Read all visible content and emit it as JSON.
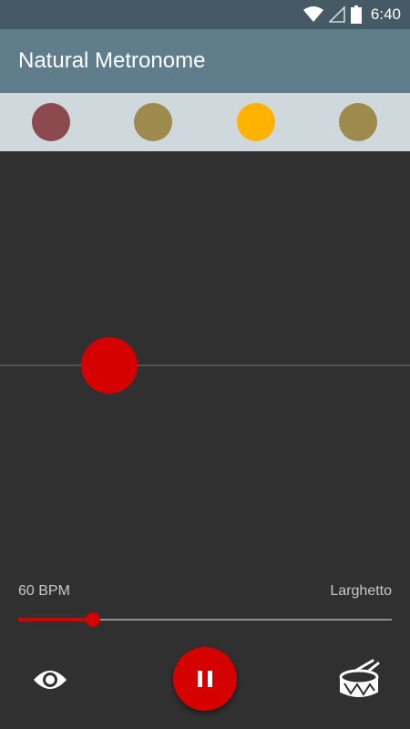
{
  "status_bar": {
    "time": "6:40",
    "icons": [
      "wifi-icon",
      "cell-signal-icon",
      "battery-icon"
    ]
  },
  "app_bar": {
    "title": "Natural Metronome"
  },
  "beat_indicators": [
    {
      "color": "#8d4a4e"
    },
    {
      "color": "#9f8a4e"
    },
    {
      "color": "#ffb300"
    },
    {
      "color": "#9f8a4e"
    }
  ],
  "tempo": {
    "bpm_label": "60 BPM",
    "name": "Larghetto",
    "slider_fraction": 0.2
  },
  "controls": {
    "visibility_icon": "eye-icon",
    "play_pause_icon": "pause-icon",
    "sound_icon": "drum-icon"
  },
  "colors": {
    "accent": "#d50000",
    "app_bar": "#607d8b",
    "status_bar": "#455a64",
    "beat_row": "#cfd8dc",
    "background": "#303030"
  }
}
